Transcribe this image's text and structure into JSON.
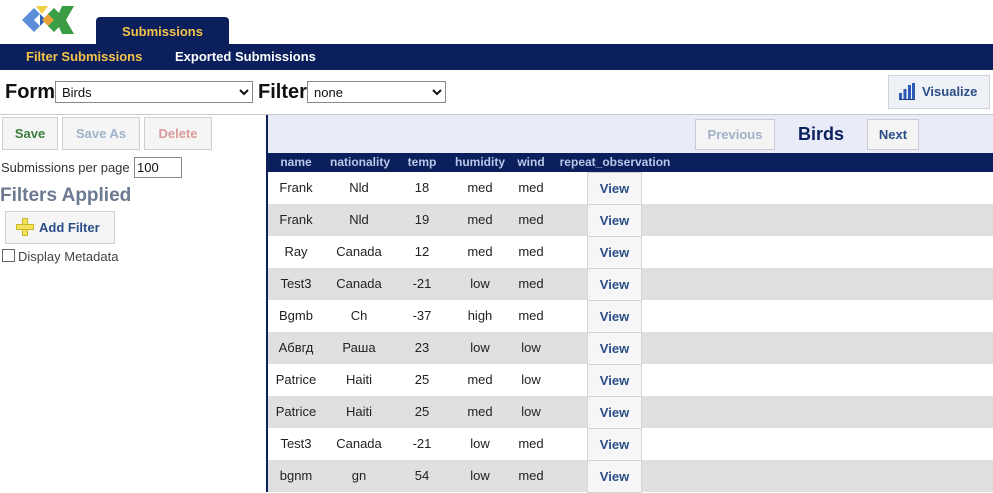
{
  "header": {
    "main_tab": "Submissions",
    "nav": [
      {
        "label": "Filter Submissions",
        "active": true
      },
      {
        "label": "Exported Submissions",
        "active": false
      }
    ]
  },
  "form_row": {
    "form_label": "Form",
    "form_value": "Birds",
    "filter_label": "Filter",
    "filter_value": "none",
    "visualize_label": "Visualize"
  },
  "left": {
    "save_label": "Save",
    "save_as_label": "Save As",
    "delete_label": "Delete",
    "per_page_label": "Submissions per page",
    "per_page_value": "100",
    "filters_applied_title": "Filters Applied",
    "add_filter_label": "Add Filter",
    "display_metadata_label": "Display Metadata"
  },
  "pager": {
    "previous_label": "Previous",
    "title": "Birds",
    "next_label": "Next"
  },
  "table": {
    "columns": [
      "name",
      "nationality",
      "temp",
      "humidity",
      "wind",
      "repeat_observation"
    ],
    "view_label": "View",
    "rows": [
      {
        "name": "Frank",
        "nationality": "Nld",
        "temp": "18",
        "humidity": "med",
        "wind": "med"
      },
      {
        "name": "Frank",
        "nationality": "Nld",
        "temp": "19",
        "humidity": "med",
        "wind": "med"
      },
      {
        "name": "Ray",
        "nationality": "Canada",
        "temp": "12",
        "humidity": "med",
        "wind": "med"
      },
      {
        "name": "Test3",
        "nationality": "Canada",
        "temp": "-21",
        "humidity": "low",
        "wind": "med"
      },
      {
        "name": "Bgmb",
        "nationality": "Ch",
        "temp": "-37",
        "humidity": "high",
        "wind": "med"
      },
      {
        "name": "Абвгд",
        "nationality": "Раша",
        "temp": "23",
        "humidity": "low",
        "wind": "low"
      },
      {
        "name": "Patrice",
        "nationality": "Haiti",
        "temp": "25",
        "humidity": "med",
        "wind": "low"
      },
      {
        "name": "Patrice",
        "nationality": "Haiti",
        "temp": "25",
        "humidity": "med",
        "wind": "low"
      },
      {
        "name": "Test3",
        "nationality": "Canada",
        "temp": "-21",
        "humidity": "low",
        "wind": "med"
      },
      {
        "name": "bgnm",
        "nationality": "gn",
        "temp": "54",
        "humidity": "low",
        "wind": "med"
      }
    ]
  },
  "colors": {
    "nav_bg": "#0a1f5c",
    "accent": "#f5c34a",
    "link_blue": "#2a4e86",
    "row_alt": "#e0e0e0"
  }
}
